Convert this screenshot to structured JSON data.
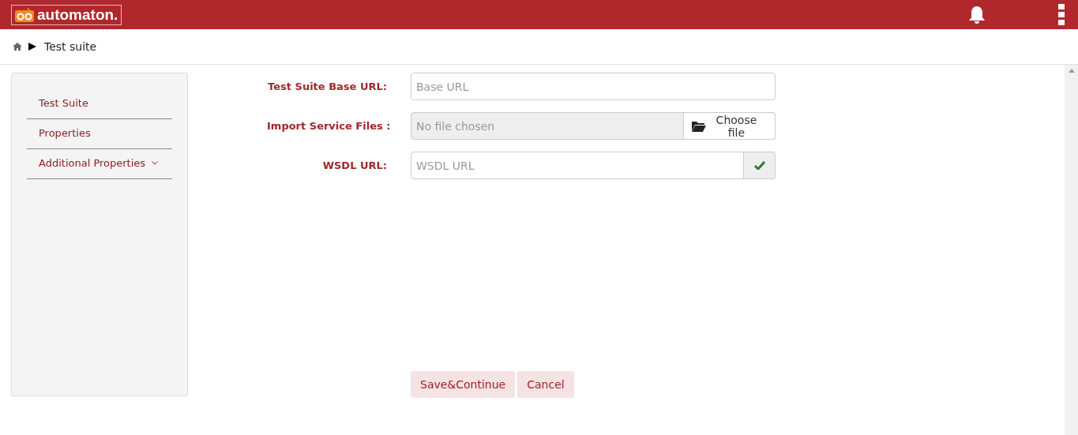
{
  "header": {
    "logo": "automaton."
  },
  "breadcrumb": {
    "current": "Test suite"
  },
  "sidebar": {
    "items": [
      {
        "label": "Test Suite",
        "expandable": false
      },
      {
        "label": "Properties",
        "expandable": false
      },
      {
        "label": "Additional Properties",
        "expandable": true
      }
    ]
  },
  "form": {
    "fields": [
      {
        "kind": "text",
        "label": "Test Suite Base URL:",
        "placeholder": "Base URL"
      },
      {
        "kind": "file",
        "label": "Import Service Files :",
        "status": "No file chosen",
        "button": "Choose file"
      },
      {
        "kind": "verify",
        "label": "WSDL URL:",
        "placeholder": "WSDL URL"
      }
    ],
    "buttons": [
      "Save&Continue",
      "Cancel"
    ]
  }
}
